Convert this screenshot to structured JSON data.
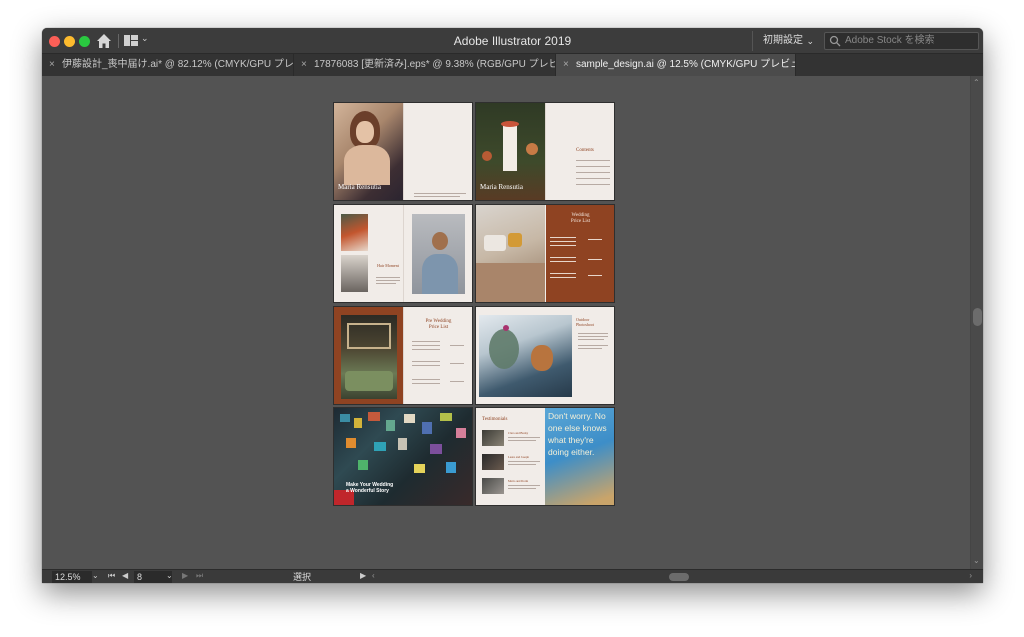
{
  "titlebar": {
    "app_title": "Adobe Illustrator 2019",
    "preset_label": "初期設定",
    "search_placeholder": "Adobe Stock を検索"
  },
  "tabs": [
    {
      "label": "伊藤設計_喪中届け.ai* @ 82.12% (CMYK/GPU プレビュー)",
      "active": false
    },
    {
      "label": "17876083 [更新済み].eps* @ 9.38% (RGB/GPU プレビュー)",
      "active": false
    },
    {
      "label": "sample_design.ai @ 12.5% (CMYK/GPU プレビュー)",
      "active": true
    }
  ],
  "artboards": {
    "cover_name": "Maria Rensutia",
    "contents_title": "Contents",
    "hair_title": "Hair Moment",
    "wedding_title_1": "Wedding",
    "wedding_title_2": "Price List",
    "pre_wedding_title_1": "Pre Wedding",
    "pre_wedding_title_2": "Price List",
    "outdoor_title_1": "Outdoor",
    "outdoor_title_2": "Photoshoot",
    "make_story_1": "Make Your Wedding",
    "make_story_2": "a Wonderful Story",
    "testimonials_title": "Testimonials",
    "t1": "Clara and Bucky",
    "t2": "Laura and Joseph",
    "t3": "Mario and Dorin",
    "quote": "Don't worry. No one else knows what they're doing either."
  },
  "statusbar": {
    "zoom": "12.5%",
    "page": "8",
    "mode": "選択"
  },
  "colors": {
    "canvas": "#535353",
    "titlebar": "#3c3c3c",
    "accent_rust": "#8f4322",
    "page_cream": "#f1ece8"
  },
  "icons": [
    "home-icon",
    "workspace-icon",
    "search-icon",
    "close-icon",
    "first-page-icon",
    "prev-page-icon",
    "next-page-icon",
    "last-page-icon"
  ]
}
